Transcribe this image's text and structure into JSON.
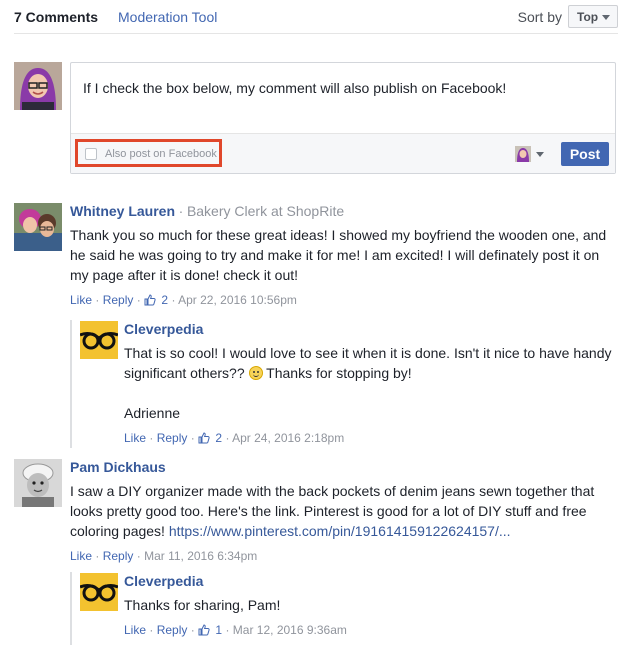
{
  "header": {
    "comment_count": "7 Comments",
    "moderation_tool": "Moderation Tool",
    "sort_by": "Sort by",
    "sort_value": "Top"
  },
  "composer": {
    "text": "If I check the box below, my comment will also publish on Facebook!",
    "checkbox_label": "Also post on Facebook",
    "checkbox_checked": false,
    "post_button": "Post"
  },
  "comments": [
    {
      "author": "Whitney Lauren",
      "separator": "·",
      "subtitle": "Bakery Clerk at ShopRite",
      "text_lines": [
        "Thank you so much for these great ideas! I showed my boyfriend the wooden one, and",
        "he said he was going to try and make it for me! I am excited! I will definately post it on",
        "my page after it is done! check it out!"
      ],
      "like": "Like",
      "reply": "Reply",
      "likes": "2",
      "date": "Apr 22, 2016 10:56pm",
      "replies": [
        {
          "author": "Cleverpedia",
          "text_line1": "That is so cool! I would love to see it when it is done. Isn't it nice to have handy",
          "text_line2a": "significant others??",
          "text_line2b": "Thanks for stopping by!",
          "signature": "Adrienne",
          "like": "Like",
          "reply": "Reply",
          "likes": "2",
          "date": "Apr 24, 2016 2:18pm"
        }
      ]
    },
    {
      "author": "Pam Dickhaus",
      "text_lines": [
        "I saw a DIY organizer made with the back pockets of denim jeans sewn together that",
        "looks pretty good too. Here's the link. Pinterest is good for a lot of DIY stuff and free"
      ],
      "text_line3": "coloring pages!",
      "link": "https://www.pinterest.com/pin/191614159122624157/...",
      "like": "Like",
      "reply": "Reply",
      "date": "Mar 11, 2016 6:34pm",
      "replies": [
        {
          "author": "Cleverpedia",
          "text": "Thanks for sharing, Pam!",
          "like": "Like",
          "reply": "Reply",
          "likes": "1",
          "date": "Mar 12, 2016 9:36am"
        }
      ]
    }
  ],
  "dot": "·",
  "colors": {
    "link": "#365899",
    "button": "#4267b2",
    "highlight_border": "#e0472b"
  }
}
